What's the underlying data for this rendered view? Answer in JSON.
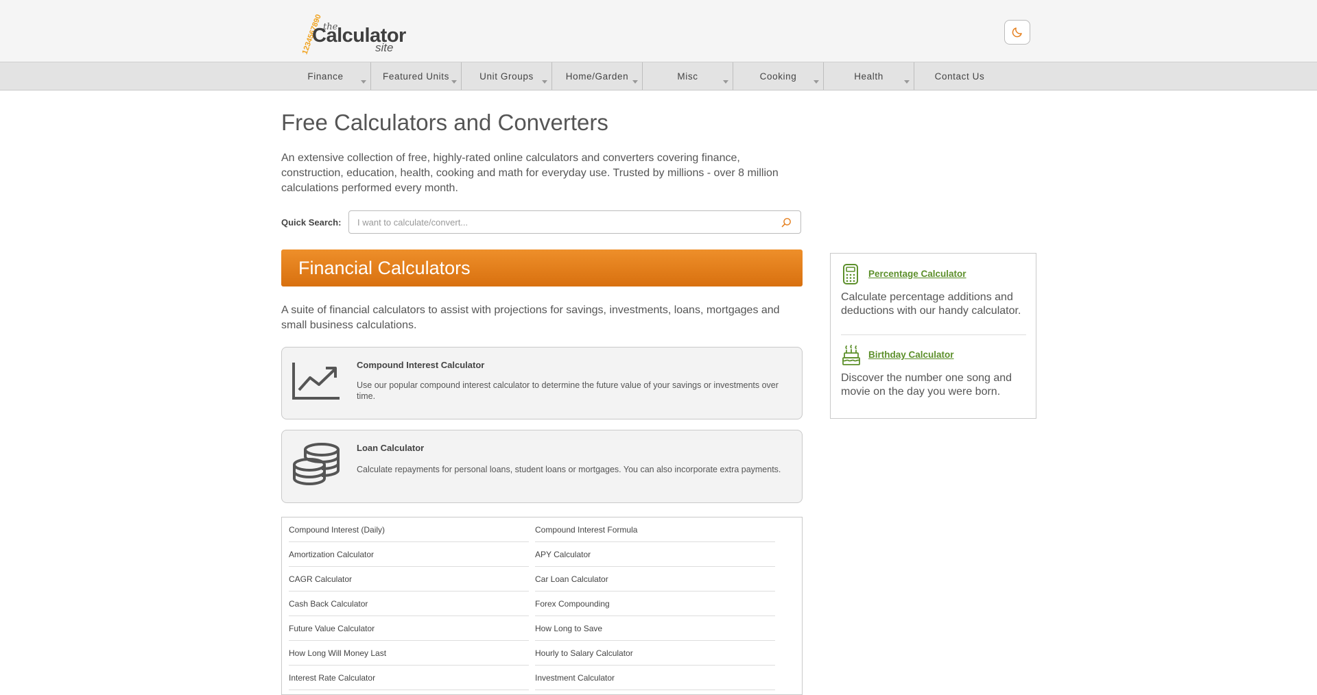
{
  "header": {
    "logo": {
      "digits": "1234567890",
      "the": "the",
      "main": "Calculator",
      "site": "site"
    },
    "theme_toggle": "moon-icon"
  },
  "nav": {
    "items": [
      {
        "label": "Finance",
        "dropdown": true
      },
      {
        "label": "Featured Units",
        "dropdown": true
      },
      {
        "label": "Unit Groups",
        "dropdown": true
      },
      {
        "label": "Home/Garden",
        "dropdown": true
      },
      {
        "label": "Misc",
        "dropdown": true
      },
      {
        "label": "Cooking",
        "dropdown": true
      },
      {
        "label": "Health",
        "dropdown": true
      },
      {
        "label": "Contact Us",
        "dropdown": false
      }
    ]
  },
  "main": {
    "title": "Free Calculators and Converters",
    "intro": "An extensive collection of free, highly-rated online calculators and converters covering finance, construction, education, health, cooking and math for everyday use. Trusted by millions - over 8 million calculations performed every month.",
    "quick_search": {
      "label": "Quick Search:",
      "placeholder": "I want to calculate/convert...",
      "value": ""
    },
    "section": {
      "title": "Financial Calculators",
      "description": "A suite of financial calculators to assist with projections for savings, investments, loans, mortgages and small business calculations."
    },
    "cards": [
      {
        "icon": "chart-trend-icon",
        "title": "Compound Interest Calculator",
        "description": "Use our popular compound interest calculator to determine the future value of your savings or investments over time."
      },
      {
        "icon": "coins-stack-icon",
        "title": "Loan Calculator",
        "description": "Calculate repayments for personal loans, student loans or mortgages. You can also incorporate extra payments."
      }
    ],
    "links": {
      "left": [
        "Compound Interest (Daily)",
        "Amortization Calculator",
        "CAGR Calculator",
        "Cash Back Calculator",
        "Future Value Calculator",
        "How Long Will Money Last",
        "Interest Rate Calculator"
      ],
      "right": [
        "Compound Interest Formula",
        "APY Calculator",
        "Car Loan Calculator",
        "Forex Compounding",
        "How Long to Save",
        "Hourly to Salary Calculator",
        "Investment Calculator"
      ]
    }
  },
  "sidebar": {
    "entries": [
      {
        "icon": "calculator-icon",
        "title": "Percentage Calculator",
        "description": "Calculate percentage additions and deductions with our handy calculator."
      },
      {
        "icon": "birthday-cake-icon",
        "title": "Birthday Calculator",
        "description": "Discover the number one song and movie on the day you were born."
      }
    ]
  },
  "colors": {
    "accent": "#e57f1d",
    "link_green": "#5c8f2a",
    "logo_orange": "#f0a21e"
  }
}
